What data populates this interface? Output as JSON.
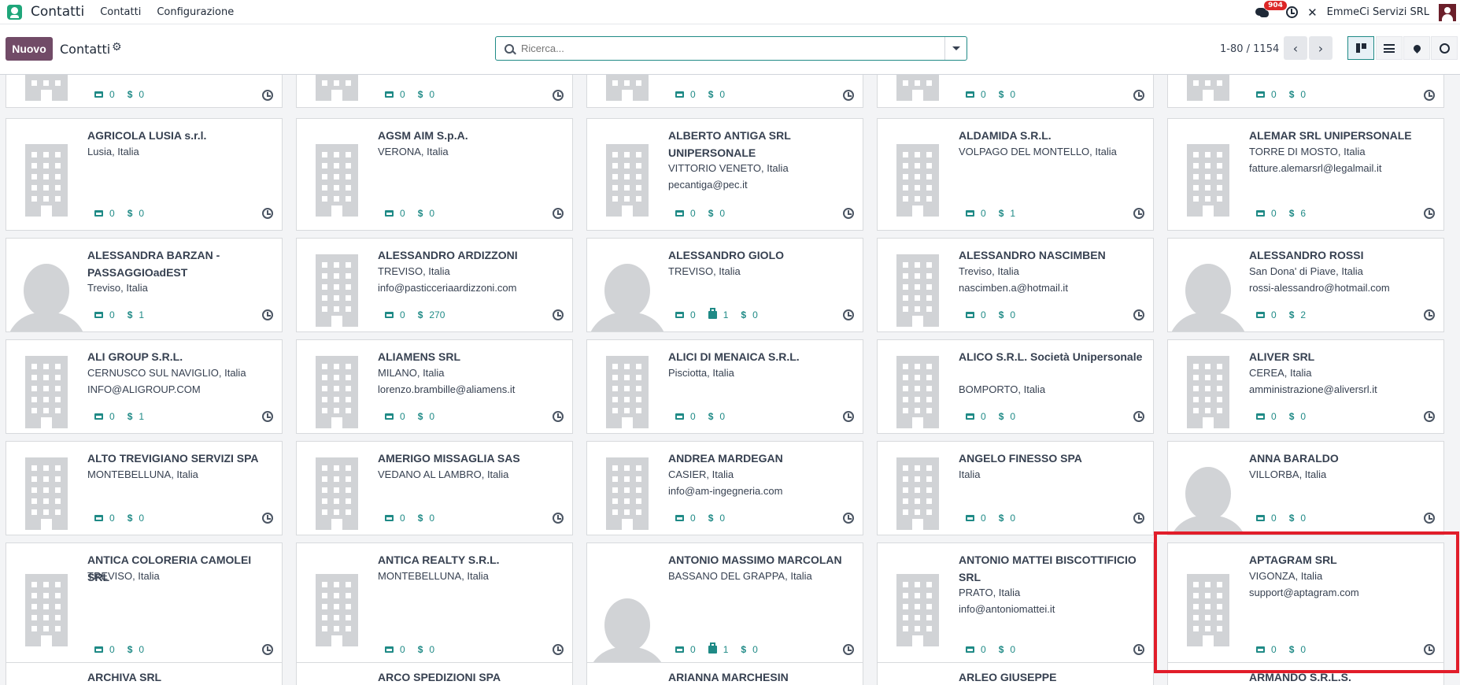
{
  "navbar": {
    "app_name": "Contatti",
    "menus": [
      "Contatti",
      "Configurazione"
    ],
    "message_count": "904",
    "company": "EmmeCi Servizi SRL"
  },
  "controlbar": {
    "new_label": "Nuovo",
    "breadcrumb": "Contatti",
    "search_placeholder": "Ricerca...",
    "pager": "1-80 / 1154"
  },
  "top_partial_row": [
    {
      "a": "0",
      "b": "0"
    },
    {
      "a": "0",
      "b": "0"
    },
    {
      "a": "0",
      "b": "0"
    },
    {
      "a": "0",
      "b": "0"
    },
    {
      "a": "0",
      "b": "0"
    }
  ],
  "rows": [
    [
      {
        "name": "AGRICOLA LUSIA s.r.l.",
        "city": "Lusia, Italia",
        "email": "",
        "a": "0",
        "b": "0",
        "img": "bld"
      },
      {
        "name": "AGSM AIM S.p.A.",
        "city": "VERONA, Italia",
        "email": "",
        "a": "0",
        "b": "0",
        "img": "bld"
      },
      {
        "name": "ALBERTO ANTIGA SRL UNIPERSONALE",
        "city": "VITTORIO VENETO, Italia",
        "email": "pecantiga@pec.it",
        "a": "0",
        "b": "0",
        "img": "bld"
      },
      {
        "name": "ALDAMIDA S.R.L.",
        "city": "VOLPAGO DEL MONTELLO, Italia",
        "email": "",
        "a": "0",
        "b": "1",
        "img": "bld"
      },
      {
        "name": "ALEMAR SRL UNIPERSONALE",
        "city": "TORRE DI MOSTO, Italia",
        "email": "fatture.alemarsrl@legalmail.it",
        "a": "0",
        "b": "6",
        "img": "bld"
      }
    ],
    [
      {
        "name": "ALESSANDRA BARZAN - PASSAGGIOadEST",
        "city": "Treviso, Italia",
        "email": "",
        "a": "0",
        "b": "1",
        "img": "person"
      },
      {
        "name": "ALESSANDRO ARDIZZONI",
        "city": "TREVISO, Italia",
        "email": "info@pasticceriaardizzoni.com",
        "a": "0",
        "b": "270",
        "img": "bld"
      },
      {
        "name": "ALESSANDRO GIOLO",
        "city": "TREVISO, Italia",
        "email": "",
        "a": "0",
        "bag": "1",
        "b": "0",
        "img": "person"
      },
      {
        "name": "ALESSANDRO NASCIMBEN",
        "city": "Treviso, Italia",
        "email": "nascimben.a@hotmail.it",
        "a": "0",
        "b": "0",
        "img": "bld"
      },
      {
        "name": "ALESSANDRO ROSSI",
        "city": "San Dona' di Piave, Italia",
        "email": "rossi-alessandro@hotmail.com",
        "a": "0",
        "b": "2",
        "img": "person"
      }
    ],
    [
      {
        "name": "ALI GROUP S.R.L.",
        "city": "CERNUSCO SUL NAVIGLIO, Italia",
        "email": "INFO@ALIGROUP.COM",
        "a": "0",
        "b": "1",
        "img": "bld"
      },
      {
        "name": "ALIAMENS SRL",
        "city": "MILANO, Italia",
        "email": "lorenzo.brambille@aliamens.it",
        "a": "0",
        "b": "0",
        "img": "bld"
      },
      {
        "name": "ALICI DI MENAICA S.R.L.",
        "city": "Pisciotta, Italia",
        "email": "",
        "a": "0",
        "b": "0",
        "img": "bld"
      },
      {
        "name": "ALICO S.R.L. Società Unipersonale",
        "city": "BOMPORTO, Italia",
        "email": "",
        "a": "0",
        "b": "0",
        "img": "bld"
      },
      {
        "name": "ALIVER SRL",
        "city": "CEREA, Italia",
        "email": "amministrazione@aliversrl.it",
        "a": "0",
        "b": "0",
        "img": "bld"
      }
    ],
    [
      {
        "name": "ALTO TREVIGIANO SERVIZI SPA",
        "city": "MONTEBELLUNA, Italia",
        "email": "",
        "a": "0",
        "b": "0",
        "img": "bld"
      },
      {
        "name": "AMERIGO MISSAGLIA SAS",
        "city": "VEDANO AL LAMBRO, Italia",
        "email": "",
        "a": "0",
        "b": "0",
        "img": "bld"
      },
      {
        "name": "ANDREA MARDEGAN",
        "city": "CASIER, Italia",
        "email": "info@am-ingegneria.com",
        "a": "0",
        "b": "0",
        "img": "bld"
      },
      {
        "name": "ANGELO FINESSO SPA",
        "city": "Italia",
        "email": "",
        "a": "0",
        "b": "0",
        "img": "bld"
      },
      {
        "name": "ANNA BARALDO",
        "city": "VILLORBA, Italia",
        "email": "",
        "a": "0",
        "b": "0",
        "img": "person"
      }
    ],
    [
      {
        "name": "ANTICA COLORERIA CAMOLEI SRL",
        "city": "TREVISO, Italia",
        "email": "",
        "a": "0",
        "b": "0",
        "img": "bld"
      },
      {
        "name": "ANTICA REALTY S.R.L.",
        "city": "MONTEBELLUNA, Italia",
        "email": "",
        "a": "0",
        "b": "0",
        "img": "bld"
      },
      {
        "name": "ANTONIO MASSIMO MARCOLAN",
        "city": "BASSANO DEL GRAPPA, Italia",
        "email": "",
        "a": "0",
        "bag": "1",
        "b": "0",
        "img": "person"
      },
      {
        "name": "ANTONIO MATTEI BISCOTTIFICIO SRL",
        "city": "PRATO, Italia",
        "email": "info@antoniomattei.it",
        "a": "0",
        "b": "0",
        "img": "bld"
      },
      {
        "name": "APTAGRAM SRL",
        "city": "VIGONZA, Italia",
        "email": "support@aptagram.com",
        "a": "0",
        "b": "0",
        "img": "bld"
      }
    ]
  ],
  "bottom_partial_row": [
    "ARCHIVA SRL",
    "ARCO SPEDIZIONI SPA",
    "ARIANNA MARCHESIN",
    "ARLEO GIUSEPPE",
    "ARMANDO S.R.L.S."
  ]
}
